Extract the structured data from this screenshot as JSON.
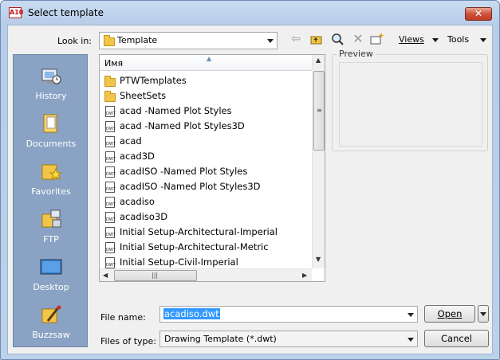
{
  "window": {
    "title": "Select template",
    "app_icon": "A10",
    "close_icon": "close-icon"
  },
  "toolbar": {
    "look_in_label": "Look in:",
    "look_in_value": "Template",
    "back_icon": "back-arrow-icon",
    "up_folder_icon": "up-one-level-icon",
    "search_icon": "search-web-icon",
    "delete_icon": "delete-icon",
    "new_folder_icon": "new-folder-icon",
    "views_label": "Views",
    "tools_label": "Tools"
  },
  "places": [
    {
      "label": "History",
      "icon": "history-icon"
    },
    {
      "label": "Documents",
      "icon": "documents-icon"
    },
    {
      "label": "Favorites",
      "icon": "favorites-icon"
    },
    {
      "label": "FTP",
      "icon": "ftp-icon"
    },
    {
      "label": "Desktop",
      "icon": "desktop-icon"
    },
    {
      "label": "Buzzsaw",
      "icon": "buzzsaw-icon"
    }
  ],
  "file_list": {
    "column_header": "Имя",
    "items": [
      {
        "name": "PTWTemplates",
        "type": "folder"
      },
      {
        "name": "SheetSets",
        "type": "folder"
      },
      {
        "name": "acad -Named Plot Styles",
        "type": "dwt"
      },
      {
        "name": "acad -Named Plot Styles3D",
        "type": "dwt"
      },
      {
        "name": "acad",
        "type": "dwt"
      },
      {
        "name": "acad3D",
        "type": "dwt"
      },
      {
        "name": "acadISO -Named Plot Styles",
        "type": "dwt"
      },
      {
        "name": "acadISO -Named Plot Styles3D",
        "type": "dwt"
      },
      {
        "name": "acadiso",
        "type": "dwt"
      },
      {
        "name": "acadiso3D",
        "type": "dwt"
      },
      {
        "name": "Initial Setup-Architectural-Imperial",
        "type": "dwt"
      },
      {
        "name": "Initial Setup-Architectural-Metric",
        "type": "dwt"
      },
      {
        "name": "Initial Setup-Civil-Imperial",
        "type": "dwt"
      }
    ],
    "dwt_badge": "DWT"
  },
  "preview": {
    "label": "Preview"
  },
  "bottom": {
    "file_name_label": "File name:",
    "file_name_value": "acadiso.dwt",
    "files_of_type_label": "Files of type:",
    "files_of_type_value": "Drawing Template (*.dwt)",
    "open_label": "Open",
    "cancel_label": "Cancel"
  }
}
